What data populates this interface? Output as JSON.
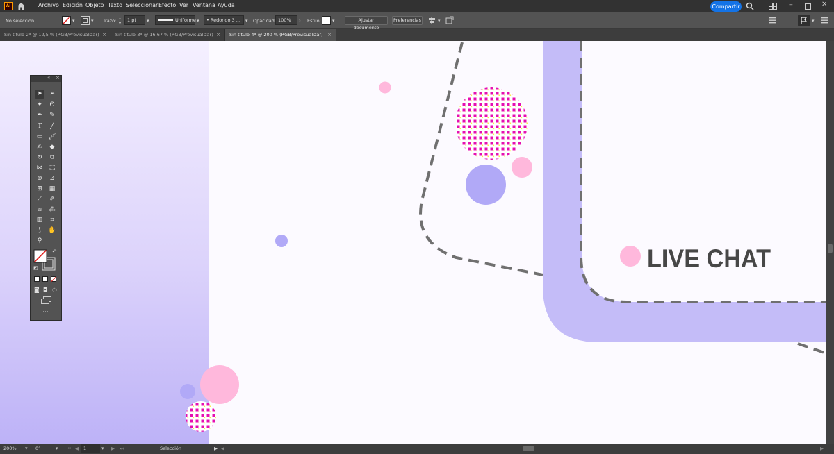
{
  "app": {
    "icon_text": "Ai"
  },
  "menu": [
    "Archivo",
    "Edición",
    "Objeto",
    "Texto",
    "Seleccionar",
    "Efecto",
    "Ver",
    "Ventana",
    "Ayuda"
  ],
  "share_label": "Compartir",
  "control": {
    "selection": "No selección",
    "stroke_label": "Trazo:",
    "stroke_value": "1 pt",
    "profile": "Uniforme",
    "brush": "Redondo 3 ...",
    "opacity_label": "Opacidad:",
    "opacity_value": "100%",
    "style_label": "Estilo:",
    "fit_doc": "Ajustar documento",
    "prefs": "Preferencias"
  },
  "tabs": [
    {
      "label": "Sin título-2* @ 12,5 % (RGB/Previsualizar)",
      "active": false
    },
    {
      "label": "Sin título-3* @ 16,67 % (RGB/Previsualizar)",
      "active": false
    },
    {
      "label": "Sin título-4* @ 200 % (RGB/Previsualizar)",
      "active": true
    }
  ],
  "artwork": {
    "headline": "LIVE CHAT",
    "colors": {
      "lavender": "#c4bcf8",
      "violet": "#b1a9f7",
      "pink": "#ffb8dc",
      "magenta": "#e60fb0",
      "dash": "#707070",
      "text": "#474747"
    }
  },
  "status": {
    "zoom": "200%",
    "rotation": "0°",
    "artboard": "1",
    "tool": "Selección"
  }
}
